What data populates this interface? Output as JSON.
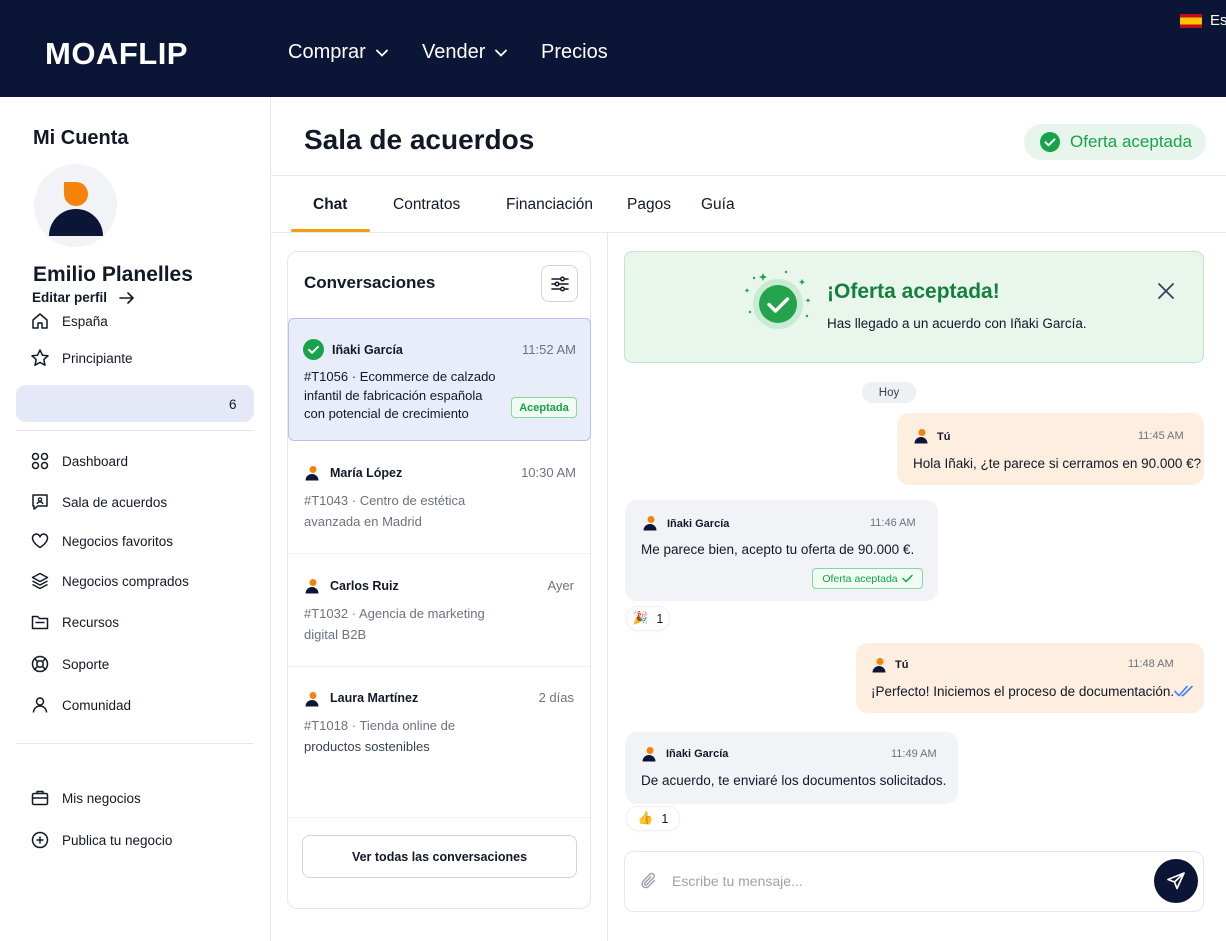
{
  "brand": {
    "logo_text": "MOAFLIP",
    "accent_color": "#f59e0b",
    "navy_color": "#0b1535",
    "success_color": "#16a34a"
  },
  "topnav": {
    "items": [
      {
        "label": "Comprar",
        "has_dropdown": true
      },
      {
        "label": "Vender",
        "has_dropdown": true
      },
      {
        "label": "Precios",
        "has_dropdown": false
      }
    ],
    "language": {
      "label": "Es",
      "icon": "spain-flag-icon"
    }
  },
  "sidebar": {
    "title": "Mi Cuenta",
    "user_name": "Emilio Planelles",
    "profile_items": [
      {
        "label": "España",
        "icon": "home-icon"
      },
      {
        "label": "Principiante",
        "icon": "star-icon"
      }
    ],
    "edit_profile": "Editar perfil",
    "menu": [
      {
        "label": "Dashboard",
        "icon": "dashboard-icon"
      },
      {
        "label": "Sala de acuerdos",
        "icon": "chat-square-icon",
        "count": "6",
        "active": true
      },
      {
        "label": "Negocios favoritos",
        "icon": "heart-icon"
      },
      {
        "label": "Negocios comprados",
        "icon": "layers-icon"
      },
      {
        "label": "Recursos",
        "icon": "folder-icon"
      },
      {
        "label": "Soporte",
        "icon": "lifebuoy-icon"
      },
      {
        "label": "Comunidad",
        "icon": "user-icon"
      }
    ],
    "bottom_menu": [
      {
        "label": "Mis negocios",
        "icon": "briefcase-icon"
      },
      {
        "label": "Publica tu negocio",
        "icon": "plus-circle-icon"
      }
    ]
  },
  "header": {
    "title": "Sala de acuerdos",
    "status": "Oferta aceptada"
  },
  "tabs": [
    {
      "label": "Chat",
      "active": true
    },
    {
      "label": "Contratos"
    },
    {
      "label": "Financiación"
    },
    {
      "label": "Pagos"
    },
    {
      "label": "Guía"
    }
  ],
  "conversations": {
    "title": "Conversaciones",
    "items": [
      {
        "name": "Iñaki García",
        "time": "11:52 AM",
        "code": "#T1056",
        "separator": "·",
        "line1": "Ecommerce de calzado",
        "line2": "infantil de fabricación española",
        "line3": "con potencial de crecimiento",
        "status": "Aceptada",
        "selected": true
      },
      {
        "name": "María López",
        "time": "10:30 AM",
        "code": "#T1043",
        "separator": "·",
        "line1": "Centro de estética",
        "line2": "avanzada en Madrid"
      },
      {
        "name": "Carlos Ruiz",
        "time": "Ayer",
        "code": "#T1032",
        "separator": "·",
        "line1": "Agencia de marketing",
        "line2": "digital B2B"
      },
      {
        "name": "Laura Martínez",
        "time": "2 días",
        "code": "#T1018",
        "separator": "·",
        "line1": "Tienda online de",
        "line2": "productos sostenibles"
      }
    ],
    "see_all": "Ver todas las conversaciones"
  },
  "chat": {
    "banner": {
      "title": "¡Oferta aceptada!",
      "text": "Has llegado a un acuerdo con Iñaki García."
    },
    "day_label": "Hoy",
    "messages": [
      {
        "author": "Tú",
        "time": "11:45 AM",
        "text": "Hola Iñaki, ¿te parece si cerramos en 90.000 €?",
        "mine": true
      },
      {
        "author": "Iñaki García",
        "time": "11:46 AM",
        "text": "Me parece bien, acepto tu oferta de 90.000 €.",
        "tag": "Oferta aceptada",
        "reaction": {
          "emoji": "🎉",
          "count": "1"
        }
      },
      {
        "author": "Tú",
        "time": "11:48 AM",
        "text": "¡Perfecto! Iniciemos el proceso de documentación.",
        "mine": true,
        "read": true
      },
      {
        "author": "Iñaki García",
        "time": "11:49 AM",
        "text": "De acuerdo, te enviaré los documentos solicitados.",
        "reaction": {
          "emoji": "👍",
          "count": "1"
        }
      }
    ],
    "composer": {
      "placeholder": "Escribe tu mensaje..."
    }
  }
}
